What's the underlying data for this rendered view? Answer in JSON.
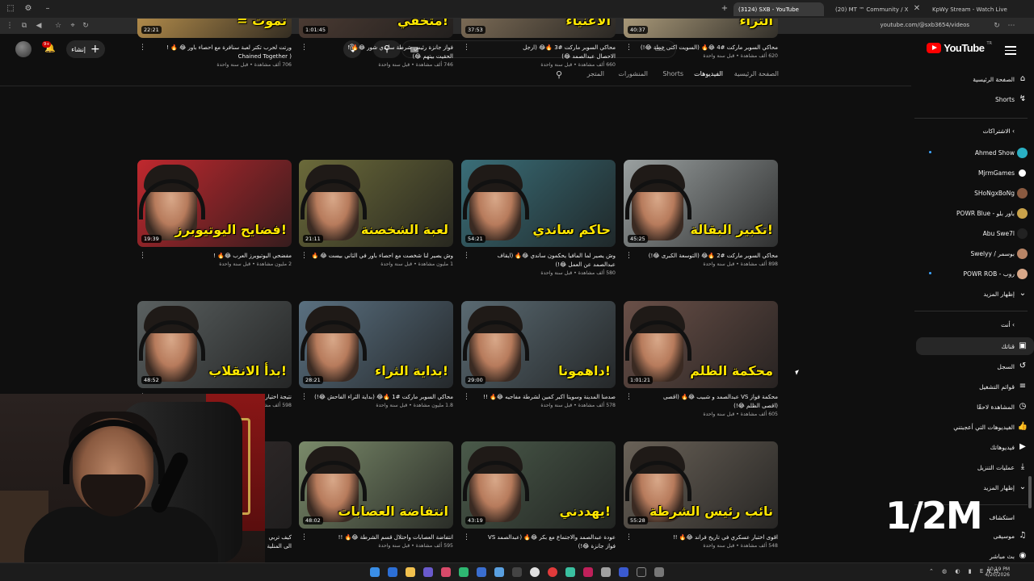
{
  "browser": {
    "tabs": [
      {
        "label": "(3124) SXB - YouTube",
        "active": true
      },
      {
        "label": "(20) MT ™ Community / X",
        "active": false
      },
      {
        "label": "KpWy Stream - Watch Live on",
        "active": false
      }
    ],
    "url": "youtube.com/@sxb3654/videos"
  },
  "header": {
    "logo_text": "YouTube",
    "logo_sup": "TR",
    "search_placeholder": "بحث",
    "create_label": "إنشاء",
    "notification_count": "9+"
  },
  "channel_tabs": [
    {
      "label": "الصفحة الرئيسية",
      "active": false
    },
    {
      "label": "الفيديوهات",
      "active": true
    },
    {
      "label": "Shorts",
      "active": false
    },
    {
      "label": "المنشورات",
      "active": false
    },
    {
      "label": "المتجر",
      "active": false
    }
  ],
  "sidebar": {
    "top": [
      {
        "label": "الصفحة الرئيسية",
        "icon": "home-icon"
      },
      {
        "label": "Shorts",
        "icon": "shorts-icon"
      }
    ],
    "subs_heading": "الاشتراكات",
    "subscriptions": [
      {
        "label": "Ahmed Show",
        "color": "#2ab0c4",
        "live": true
      },
      {
        "label": "MjrmGames",
        "color": "#ffffff",
        "live": false
      },
      {
        "label": "SHoNgxBoNg",
        "color": "#8a5a40",
        "live": false
      },
      {
        "label": "POWR Blue - باور بلو",
        "color": "#c9a24a",
        "live": false
      },
      {
        "label": "Abu Swe7l",
        "color": "#222222",
        "live": false
      },
      {
        "label": "Swelyy / بوسمر",
        "color": "#b98566",
        "live": false
      },
      {
        "label": "POWR ROB - روب",
        "color": "#d8a889",
        "live": true
      }
    ],
    "show_more_1": "إظهار المزيد",
    "you_heading": "أنت",
    "you_items": [
      {
        "label": "قناتك",
        "icon": "channel-icon",
        "active": true
      },
      {
        "label": "السجل",
        "icon": "history-icon",
        "active": false
      },
      {
        "label": "قوائم التشغيل",
        "icon": "playlist-icon",
        "active": false
      },
      {
        "label": "المشاهدة لاحقًا",
        "icon": "watch-later-icon",
        "active": false
      },
      {
        "label": "الفيديوهات التي أعجبتني",
        "icon": "like-icon",
        "active": false
      },
      {
        "label": "فيديوهاتك",
        "icon": "your-videos-icon",
        "active": false
      },
      {
        "label": "عمليات التنزيل",
        "icon": "download-icon",
        "active": false
      }
    ],
    "show_more_2": "إظهار المزيد",
    "explore_heading": "استكشاف",
    "explore_items": [
      {
        "label": "موسيقى",
        "icon": "music-icon"
      },
      {
        "label": "بث مباشر",
        "icon": "live-icon"
      }
    ]
  },
  "videos": [
    {
      "title": "ورتت لحرب تكتر لعبة سنافرة مع احصاء باور 😂 🔥 !",
      "title2": "( Chained Together",
      "meta": "706 ألف مشاهدة • قبل سنة واحدة",
      "duration": "22:21",
      "caption": "= تموت",
      "bg": "#b08a4a"
    },
    {
      "title": "فواز جانزة رئيس شرطة ساندي شور 😂🔥 !",
      "title2": "الحقيت بيتهم 😂)",
      "meta": "746 ألف مشاهدة • قبل سنة واحدة",
      "duration": "1:01:45",
      "caption": "متخفي!",
      "bg": "#4a3a32"
    },
    {
      "title": "محاكي السوبر ماركت #3 🔥😂 (ارجل",
      "title2": "الاحصال عبدالصمد 😂)",
      "meta": "660 ألف مشاهدة • قبل سنة واحدة",
      "duration": "37:53",
      "caption": "الأغنياء",
      "bg": "#7a6a55"
    },
    {
      "title": "محاكي السوبر ماركت #4 😂🔥 (السويت اكتى خطة 😂!)",
      "title2": "",
      "meta": "620 ألف مشاهدة • قبل سنة واحدة",
      "duration": "40:37",
      "caption": "الثراء",
      "bg": "#a89878"
    },
    {
      "title": "مفضحي اليوتيوبرز العرب 😂🔥 !",
      "title2": "",
      "meta": "2 مليون مشاهدة • قبل سنة واحدة",
      "duration": "19:39",
      "caption": "فضايح اليوتيوبرز!",
      "bg": "#c0282e"
    },
    {
      "title": "وش يصير لنا شخصت مع احصاء باور في الثاني بيست 😂 🔥",
      "title2": "",
      "meta": "1 مليون مشاهدة • قبل سنة واحدة",
      "duration": "21:11",
      "caption": "لعبة الشخصنة",
      "bg": "#6b6a3a"
    },
    {
      "title": "وش يصير لما المافيا يحكمون ساندي 😂🔥 (ايقاف",
      "title2": "عبدالصمد عن العمل 😂!)",
      "meta": "580 ألف مشاهدة • قبل سنة واحدة",
      "duration": "54:21",
      "caption": "حاكم ساندي",
      "bg": "#3a6e78"
    },
    {
      "title": "محاكي السوبر ماركت #2 🔥😂 (التوسعة الكبرى 😂!)",
      "title2": "",
      "meta": "898 ألف مشاهدة • قبل سنة واحدة",
      "duration": "45:25",
      "caption": "تكبير البقالة!",
      "bg": "#9aa0a0"
    },
    {
      "title": "نتيجة اختيار",
      "title2": "",
      "meta": "598 ألف مشاهدة • قبل سنة واحدة",
      "duration": "48:52",
      "caption": "بدأ الانقلاب!",
      "bg": "#5a6060"
    },
    {
      "title": "محاكي السوبر ماركت #1 🔥😂 (بداية الثراء الفاحش 😂!)",
      "title2": "",
      "meta": "1.8 مليون مشاهدة • قبل سنة واحدة",
      "duration": "28:21",
      "caption": "بداية الثراء!",
      "bg": "#5a7080"
    },
    {
      "title": "صدمنا المدينة وسويتا اكبر كمين لشرطة مفاجيه 😂🔥 !!",
      "title2": "",
      "meta": "578 ألف مشاهدة • قبل سنة واحدة",
      "duration": "29:00",
      "caption": "داهمونا!",
      "bg": "#5a6a72"
    },
    {
      "title": "محكمة فواز VS عبدالصمد و شبيب 😂🔥 (اقصى",
      "title2": "(اقصى الظلم 😂!)",
      "meta": "605 ألف مشاهدة • قبل سنة واحدة",
      "duration": "1:01:21",
      "caption": "محكمة الظلم",
      "bg": "#6a5048"
    },
    {
      "title": "كيف تربي",
      "title2": "الى المنلية",
      "meta": "",
      "duration": "",
      "caption": "",
      "bg": "#3a3030"
    },
    {
      "title": "انتفاضة العصابات واحتلال قسم الشرطة 😂🔥 !!",
      "title2": "",
      "meta": "595 ألف مشاهدة • قبل سنة واحدة",
      "duration": "48:02",
      "caption": "انتفاضة العصابات",
      "bg": "#7a8a6a"
    },
    {
      "title": "عودة عبدالصمد والاجتماع مع بكر 😂🔥 (عبدالصمد VS",
      "title2": "فواز جانزة 😂!)",
      "meta": "",
      "duration": "43:19",
      "caption": "يهددني!",
      "bg": "#4a5a4a"
    },
    {
      "title": "اقوى اختبار عسكري في تاريخ فراند 😂🔥 !!",
      "title2": "",
      "meta": "548 ألف مشاهدة • قبل سنة واحدة",
      "duration": "55:28",
      "caption": "نائب رئيس الشرطة",
      "bg": "#6a6258"
    }
  ],
  "overlay_text": "1/2M",
  "taskbar": {
    "tray_lang": "ENG",
    "time": "10:19 PM",
    "date": "4/20/2026"
  }
}
